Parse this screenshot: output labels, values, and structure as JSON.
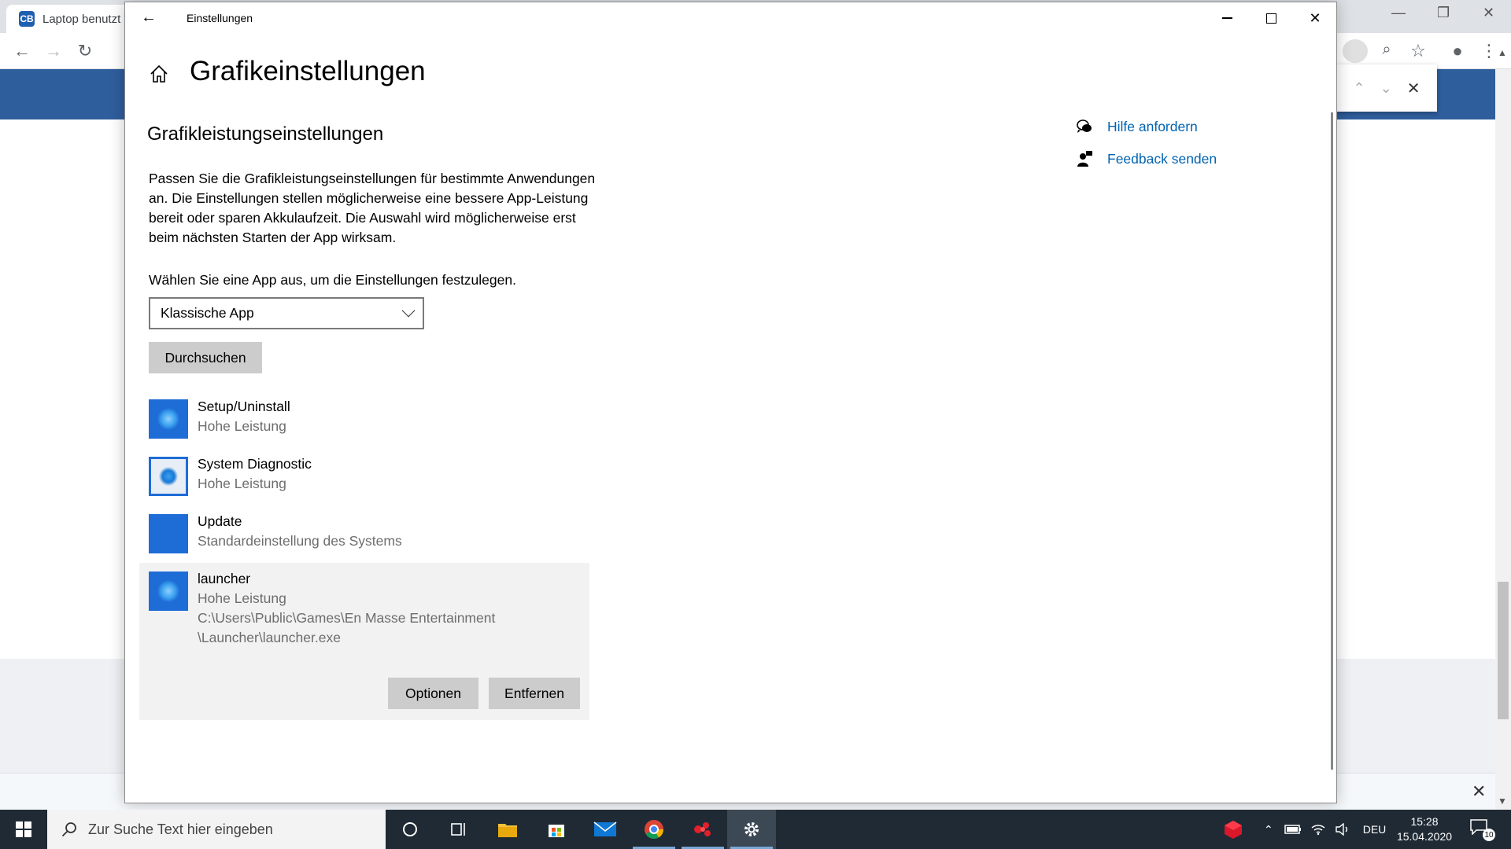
{
  "browser": {
    "tab_title": "Laptop benutzt",
    "favicon_text": "CB",
    "find_close": "✕"
  },
  "settings": {
    "window_title": "Einstellungen",
    "page_title": "Grafikeinstellungen",
    "section_heading": "Grafikleistungseinstellungen",
    "description": "Passen Sie die Grafikleistungseinstellungen für bestimmte Anwendungen an. Die Einstellungen stellen möglicherweise eine bessere App-Leistung bereit oder sparen Akkulaufzeit. Die Auswahl wird möglicherweise erst beim nächsten Starten der App wirksam.",
    "choose_label": "Wählen Sie eine App aus, um die Einstellungen festzulegen.",
    "dropdown_value": "Klassische App",
    "browse_label": "Durchsuchen",
    "apps": [
      {
        "name": "Setup/Uninstall",
        "setting": "Hohe Leistung"
      },
      {
        "name": "System Diagnostic",
        "setting": "Hohe Leistung"
      },
      {
        "name": "Update",
        "setting": "Standardeinstellung des Systems"
      },
      {
        "name": "launcher",
        "setting": "Hohe Leistung",
        "path": "C:\\Users\\Public\\Games\\En Masse Entertainment \\Launcher\\launcher.exe"
      }
    ],
    "options_label": "Optionen",
    "remove_label": "Entfernen",
    "help_link": "Hilfe anfordern",
    "feedback_link": "Feedback senden"
  },
  "taskbar": {
    "search_placeholder": "Zur Suche Text hier eingeben",
    "language": "DEU",
    "time": "15:28",
    "date": "15.04.2020",
    "notification_count": "10"
  },
  "colors": {
    "link": "#0063b1",
    "app_icon_blue": "#1e6cd6",
    "taskbar": "#1f2a34",
    "browser_banner": "#2f5e9d"
  }
}
